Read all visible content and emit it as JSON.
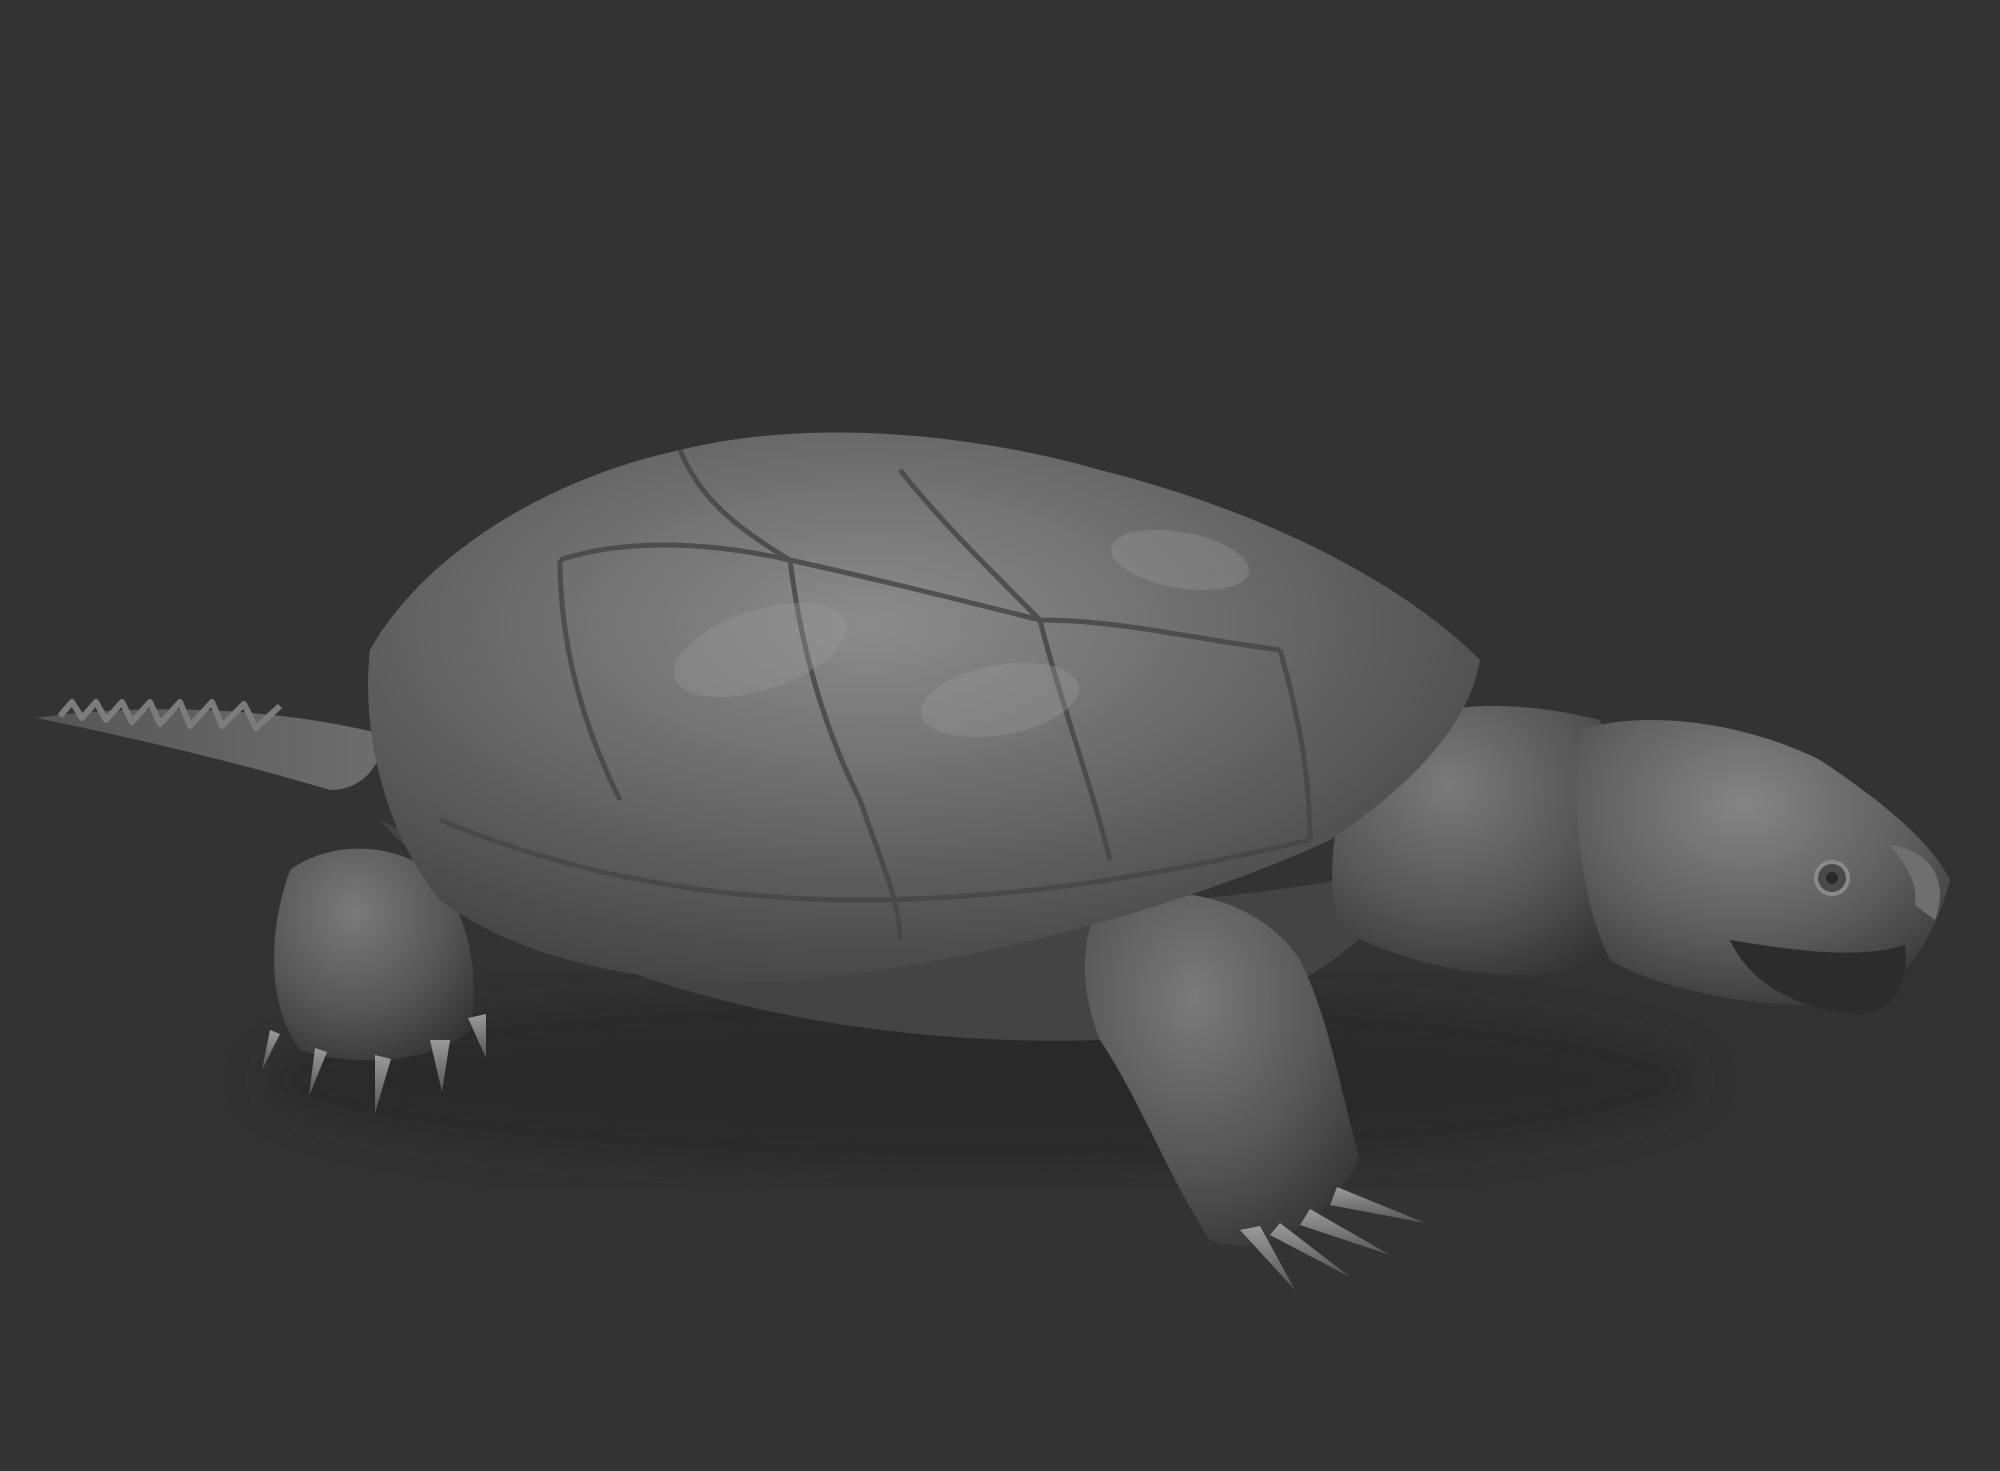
{
  "scene": {
    "background_color": "#333333",
    "subject": "snapping-turtle-sculpt",
    "material_base_color": "#5c5c5c",
    "material_highlight_color": "#8a8a8a",
    "material_shadow_color": "#2a2a2a"
  }
}
